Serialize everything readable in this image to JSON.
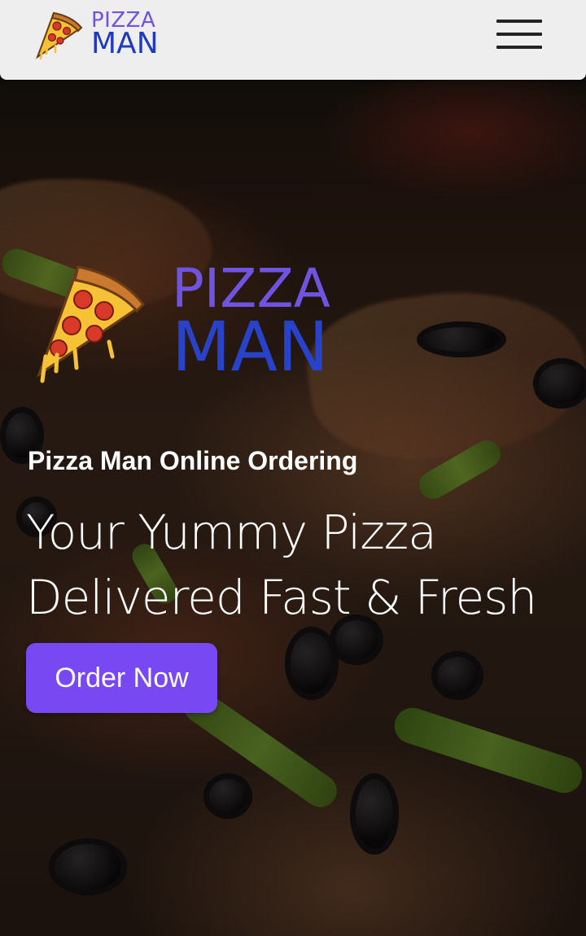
{
  "header": {
    "logo": {
      "line1": "PIZZA",
      "line2": "MAN",
      "icon": "pizza-slice-icon"
    },
    "menu_icon": "hamburger-menu-icon"
  },
  "hero": {
    "logo": {
      "line1": "PIZZA",
      "line2": "MAN",
      "icon": "pizza-slice-icon"
    },
    "kicker": "Pizza Man Online Ordering",
    "headline_line1": "Your Yummy Pizza",
    "headline_line2": "Delivered Fast & Fresh",
    "cta_label": "Order Now"
  },
  "colors": {
    "logo_top": "#6e54e0",
    "logo_bottom": "#203bbd",
    "cta": "#7849f3",
    "header_bg": "#eeeeee"
  }
}
